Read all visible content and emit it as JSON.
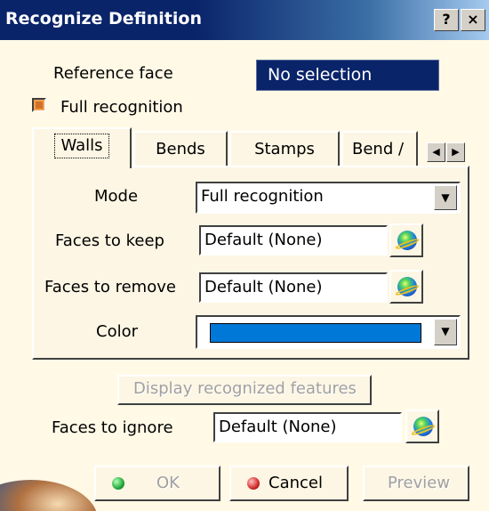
{
  "window": {
    "title": "Recognize Definition",
    "help_label": "?",
    "close_label": "×"
  },
  "reference_face": {
    "label": "Reference face",
    "value": "No selection"
  },
  "full_recognition_checkbox": {
    "label": "Full recognition",
    "checked": true
  },
  "tabs": [
    {
      "label": "Walls",
      "active": true
    },
    {
      "label": "Bends",
      "active": false
    },
    {
      "label": "Stamps",
      "active": false
    },
    {
      "label": "Bend /",
      "active": false
    }
  ],
  "tab_scroll": {
    "left_icon": "◀",
    "right_icon": "▶"
  },
  "walls_panel": {
    "mode": {
      "label": "Mode",
      "value": "Full recognition",
      "arrow": "▼"
    },
    "faces_to_keep": {
      "label": "Faces to keep",
      "value": "Default (None)",
      "icon": "selection-globe-icon"
    },
    "faces_to_remove": {
      "label": "Faces to remove",
      "value": "Default (None)",
      "icon": "selection-globe-icon"
    },
    "color": {
      "label": "Color",
      "value": "#0078d7",
      "arrow": "▼"
    }
  },
  "display_recognized_features_button": {
    "label": "Display recognized features",
    "enabled": false
  },
  "faces_to_ignore": {
    "label": "Faces to ignore",
    "value": "Default (None)",
    "icon": "selection-globe-icon"
  },
  "buttons": {
    "ok": {
      "label": "OK",
      "enabled": false,
      "dot_color": "#22a83a"
    },
    "cancel": {
      "label": "Cancel",
      "enabled": true,
      "dot_color": "#d42a2a"
    },
    "preview": {
      "label": "Preview",
      "enabled": false
    }
  }
}
